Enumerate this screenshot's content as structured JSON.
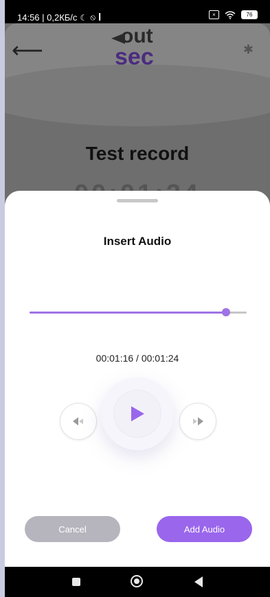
{
  "status_bar": {
    "time_info": "14:56 | 0,2КБ/с",
    "battery": "76",
    "sim_icon": "sim-x-icon",
    "wifi_icon": "wifi-icon"
  },
  "background_screen": {
    "logo_top": "out",
    "logo_bottom": "sec",
    "record_title": "Test record",
    "record_time": "00:01:24"
  },
  "sheet": {
    "title": "Insert Audio",
    "progress": 0.905,
    "time_display": "00:01:16 / 00:01:24",
    "cancel_label": "Cancel",
    "add_label": "Add Audio"
  },
  "colors": {
    "accent": "#9a66ec",
    "cancel": "#b6b5be",
    "track": "#c6c6c6"
  }
}
